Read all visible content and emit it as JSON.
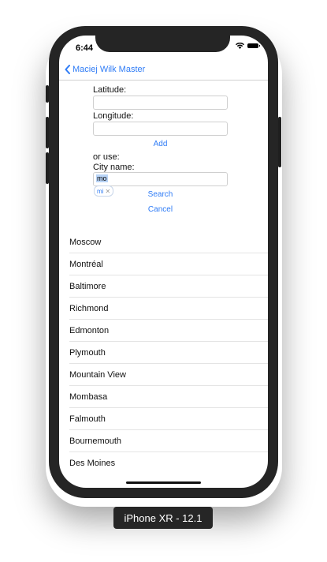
{
  "status_bar": {
    "time": "6:44"
  },
  "navbar": {
    "back_label": "Maciej Wilk Master"
  },
  "form": {
    "latitude_label": "Latitude:",
    "latitude_value": "",
    "longitude_label": "Longitude:",
    "longitude_value": "",
    "add_label": "Add",
    "or_use_label": "or use:",
    "city_name_label": "City name:",
    "city_name_value": "mo",
    "chip_label": "mi",
    "search_label": "Search",
    "cancel_label": "Cancel"
  },
  "cities": [
    "Moscow",
    "Montréal",
    "Baltimore",
    "Richmond",
    "Edmonton",
    "Plymouth",
    "Mountain View",
    "Mombasa",
    "Falmouth",
    "Bournemouth",
    "Des Moines"
  ],
  "device_label": "iPhone XR - 12.1",
  "colors": {
    "accent": "#2f7cf6",
    "frame": "#252525",
    "label_bg": "#262626"
  }
}
